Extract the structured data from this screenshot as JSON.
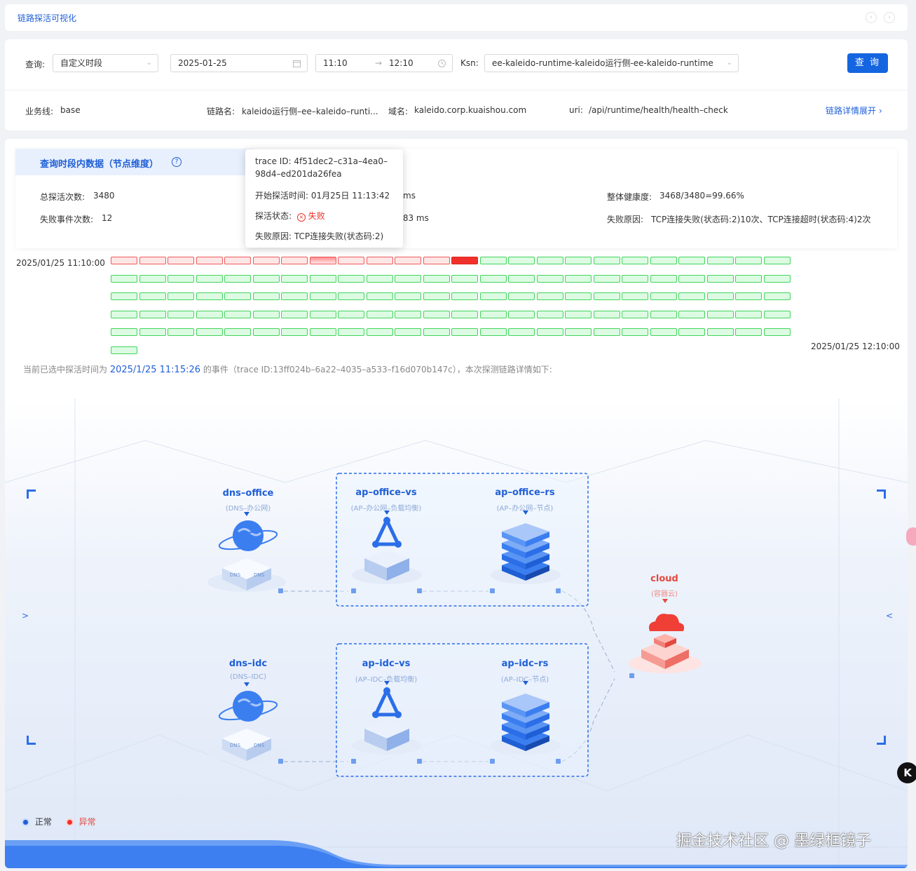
{
  "header": {
    "title": "链路探活可视化"
  },
  "query": {
    "label": "查询:",
    "range_type": "自定义时段",
    "date": "2025-01-25",
    "time_start": "11:10",
    "time_arrow": "→",
    "time_end": "12:10",
    "ksn_label": "Ksn:",
    "ksn_value": "ee-kaleido-runtime-kaleido运行侧-ee-kaleido-runtime",
    "search_button": "查 询"
  },
  "info": {
    "business_label": "业务线:",
    "business_value": "base",
    "link_label": "链路名:",
    "link_value": "kaleido运行侧–ee–kaleido–runti...",
    "domain_label": "域名:",
    "domain_value": "kaleido.corp.kuaishou.com",
    "uri_label": "uri:",
    "uri_value": "/api/runtime/health/health–check",
    "expand_link": "链路详情展开",
    "expand_icon": "›"
  },
  "stats": {
    "panel_title": "查询时段内数据（节点维度）",
    "help_icon": "?",
    "total_label": "总探活次数:",
    "total_value": "3480",
    "fail_label": "失败事件次数:",
    "fail_value": "12",
    "mid_top": "ms",
    "mid_bottom": ".83 ms",
    "health_label": "整体健康度:",
    "health_value": "3468/3480=99.66%",
    "reason_label": "失败原因:",
    "reason_value": "TCP连接失败(状态码:2)10次、TCP连接超时(状态码:4)2次"
  },
  "tooltip": {
    "trace_line1": "trace ID:  4f51dec2–c31a–4ea0–",
    "trace_line2": "98d4–ed201da26fea",
    "start_time": "开始探活时间:  01月25日 11:13:42",
    "status_label": "探活状态:",
    "status_value": "失败",
    "reason": "失败原因:  TCP连接失败(状态码:2)"
  },
  "timeline": {
    "start_label": "2025/01/25 11:10:00",
    "end_label": "2025/01/25 12:10:00",
    "cells_per_row": 24,
    "full_rows": 5,
    "last_row_cells": 1,
    "warn_cells": [
      0,
      1,
      2,
      3,
      4,
      5,
      6,
      8,
      9,
      10,
      11
    ],
    "bad_cells": [
      12
    ],
    "selected_cell": 7
  },
  "selection": {
    "prefix": "当前已选中探活时间为",
    "time": "2025/1/25 11:15:26",
    "suffix": "的事件（trace ID:13ff024b–6a22–4035–a533–f16d070b147c），本次探测链路详情如下:"
  },
  "topology": {
    "dns_office": {
      "title": "dns–office",
      "sub": "(DNS–办公网)"
    },
    "ap_office_vs": {
      "title": "ap–office–vs",
      "sub": "(AP–办公网–负载均衡)"
    },
    "ap_office_rs": {
      "title": "ap–office–rs",
      "sub": "(AP–办公网–节点)"
    },
    "cloud": {
      "title": "cloud",
      "sub": "(容器云)"
    },
    "dns_idc": {
      "title": "dns–idc",
      "sub": "(DNS–IDC)"
    },
    "ap_idc_vs": {
      "title": "ap–idc–vs",
      "sub": "(AP–IDC–负载均衡)"
    },
    "ap_idc_rs": {
      "title": "ap–idc–rs",
      "sub": "(AP–IDC–节点)"
    },
    "dns_badge": "DNS",
    "left_arrow": ">",
    "right_arrow": "<"
  },
  "legend": {
    "normal": "正常",
    "abnormal": "异常"
  },
  "watermark": "掘金技术社区 @ 墨绿框镜子",
  "colors": {
    "accent": "#1565e0",
    "ok": "#42d45c",
    "fail": "#f0312b"
  }
}
